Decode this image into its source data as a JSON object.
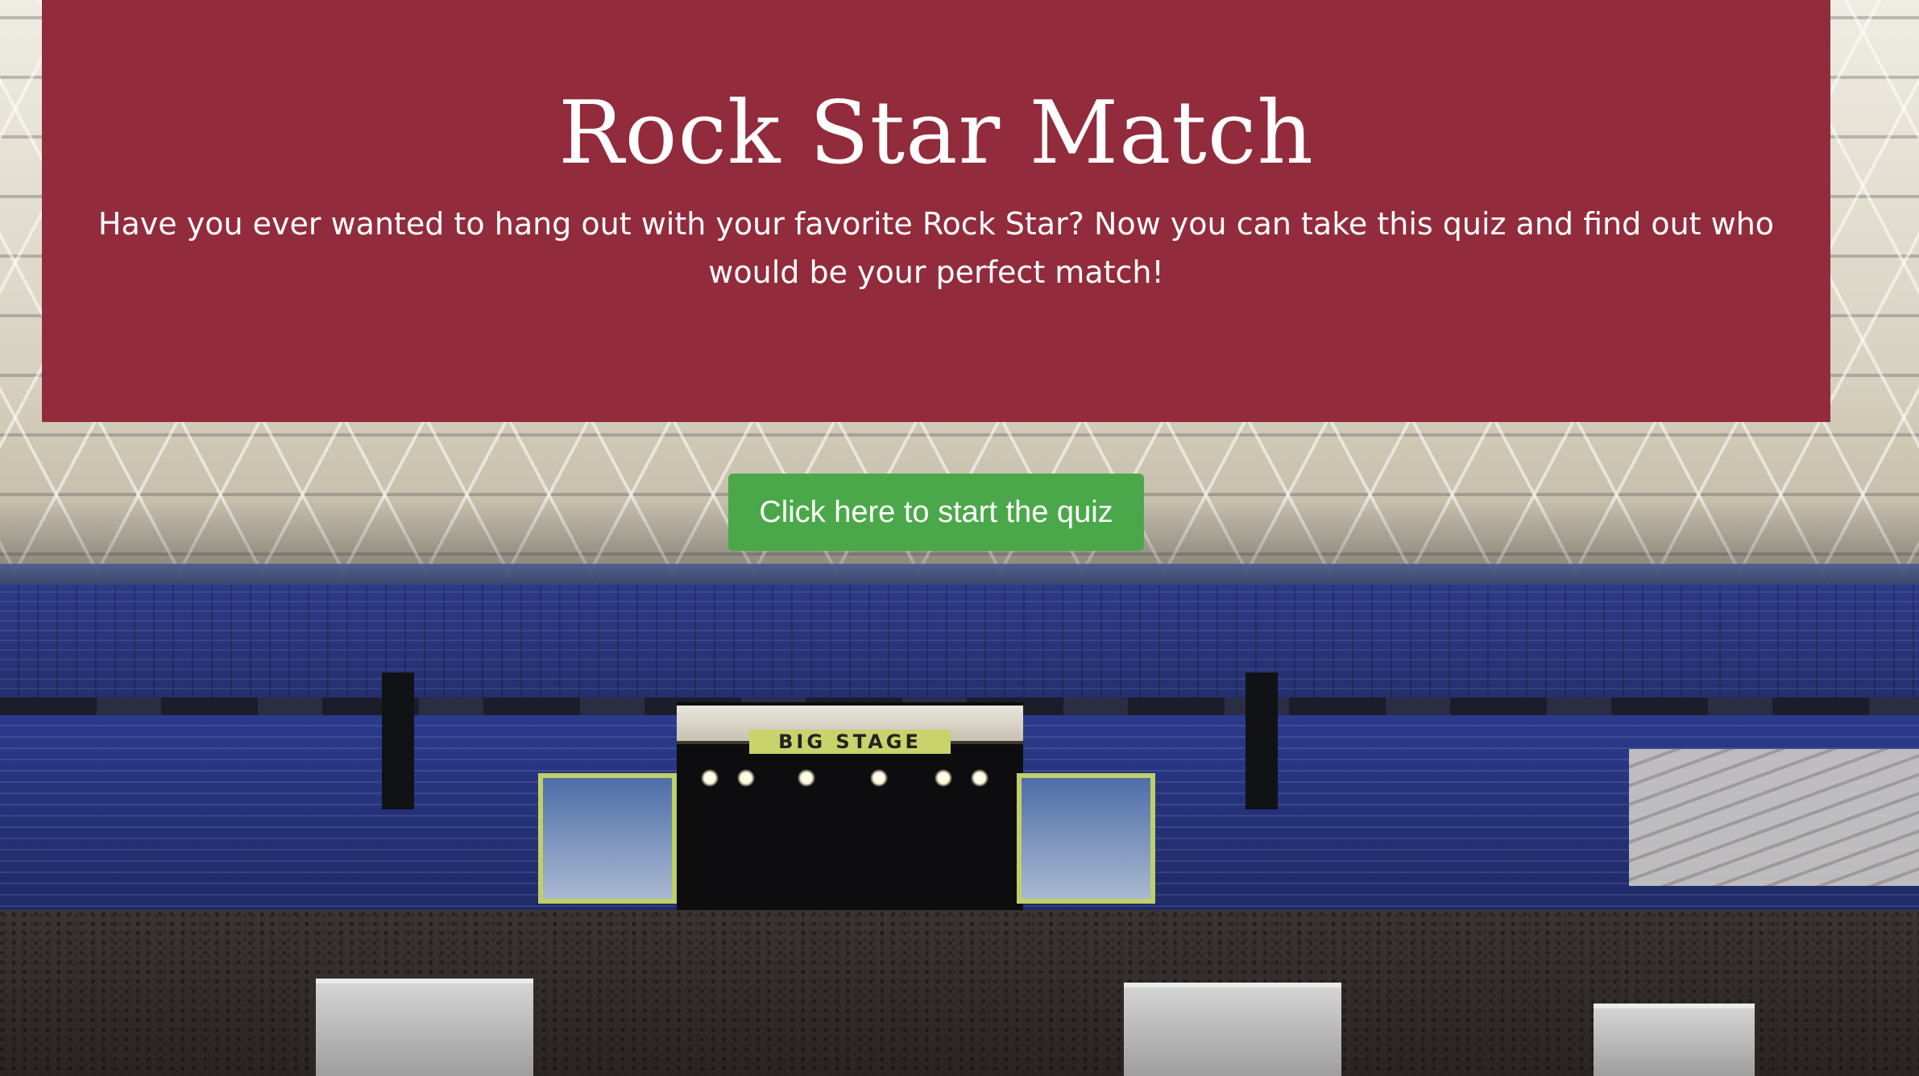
{
  "header": {
    "title": "Rock Star Match",
    "subtitle": "Have you ever wanted to hang out with your favorite Rock Star? Now you can take this quiz and find out who would be your perfect match!"
  },
  "actions": {
    "start_quiz_label": "Click here to start the quiz"
  },
  "background": {
    "stage_sign": "BIG STAGE"
  },
  "colors": {
    "header_bg": "#922b3b",
    "button_bg": "#4ba84a",
    "text": "#ffffff"
  }
}
